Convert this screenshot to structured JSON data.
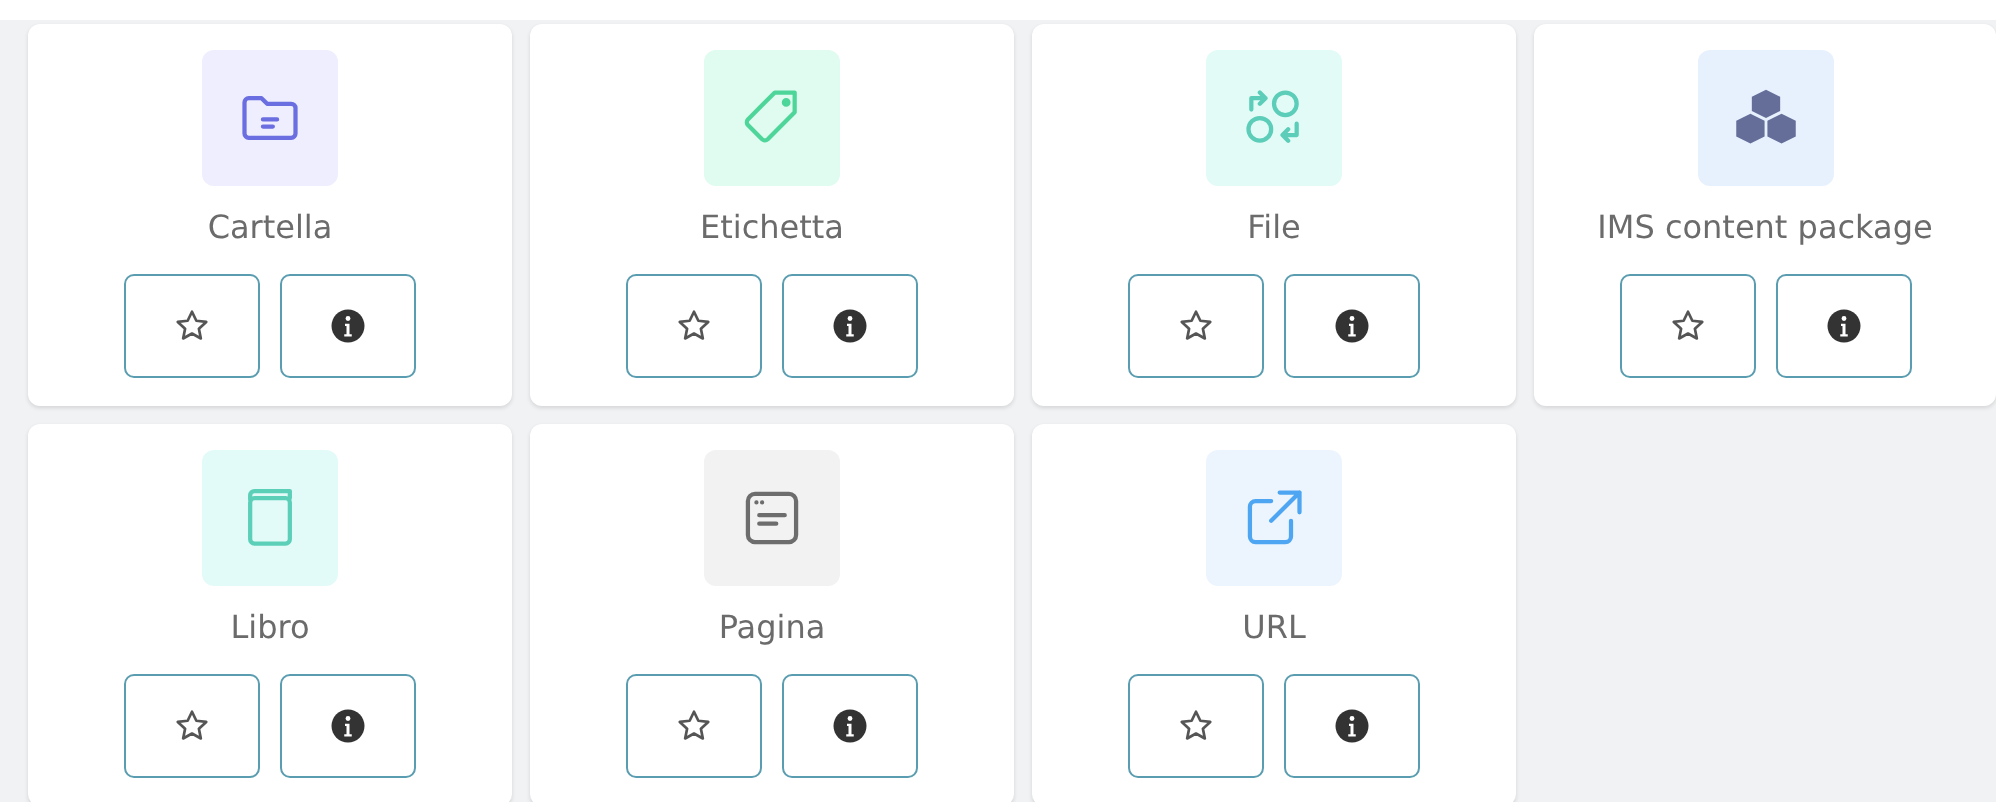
{
  "activities": [
    {
      "kind": "folder",
      "label": "Cartella"
    },
    {
      "kind": "tag",
      "label": "Etichetta"
    },
    {
      "kind": "file",
      "label": "File"
    },
    {
      "kind": "package",
      "label": "IMS content package"
    },
    {
      "kind": "book",
      "label": "Libro"
    },
    {
      "kind": "page",
      "label": "Pagina"
    },
    {
      "kind": "url",
      "label": "URL"
    }
  ]
}
